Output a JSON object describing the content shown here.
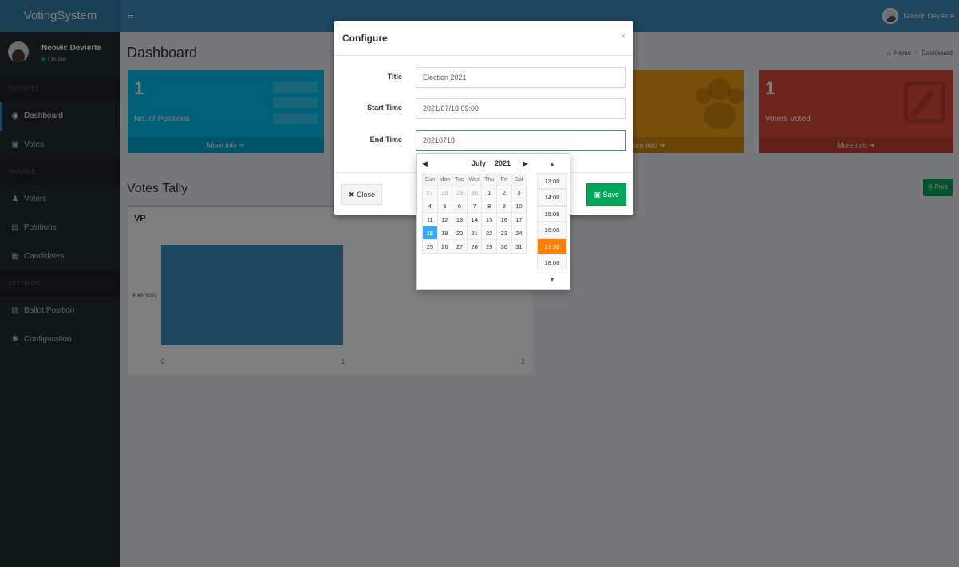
{
  "app": {
    "name": "VotingSystem",
    "toggle_glyph": "≡"
  },
  "topbar": {
    "user_name": "Neovic Devierte"
  },
  "sidebar": {
    "user": {
      "name": "Neovic Devierte",
      "status": "Online"
    },
    "sections": [
      {
        "header": "REPORTS",
        "items": [
          {
            "label": "Dashboard",
            "icon": "dashboard-icon",
            "active": true
          },
          {
            "label": "Votes",
            "icon": "lock-icon"
          }
        ]
      },
      {
        "header": "MANAGE",
        "items": [
          {
            "label": "Voters",
            "icon": "users-icon"
          },
          {
            "label": "Positions",
            "icon": "list-icon"
          },
          {
            "label": "Candidates",
            "icon": "candidates-icon"
          }
        ]
      },
      {
        "header": "SETTINGS",
        "items": [
          {
            "label": "Ballot Position",
            "icon": "file-icon"
          },
          {
            "label": "Configuration",
            "icon": "gear-icon"
          }
        ]
      }
    ]
  },
  "content": {
    "page_title": "Dashboard",
    "breadcrumb": {
      "home": "Home",
      "current": "Dashboard"
    },
    "boxes": [
      {
        "number": "1",
        "label": "No. of Positions",
        "footer": "More info",
        "color": "#00c0ef"
      },
      {
        "number": "",
        "label": "",
        "footer": "More info",
        "color": "#f39c12"
      },
      {
        "number": "1",
        "label": "Voters Voted",
        "footer": "More info",
        "color": "#dd4b39"
      }
    ],
    "section_title": "Votes Tally",
    "print_label": "Print",
    "chart_title": "VP"
  },
  "chart_data": {
    "type": "bar",
    "orientation": "horizontal",
    "title": "VP",
    "categories": [
      "Kashkov"
    ],
    "values": [
      1
    ],
    "xlim": [
      0,
      2
    ],
    "x_ticks": [
      "0",
      "1",
      "2"
    ],
    "color": "#3c8dbc"
  },
  "modal": {
    "title": "Configure",
    "close_glyph": "×",
    "fields": {
      "title": {
        "label": "Title",
        "value": "Election 2021"
      },
      "start": {
        "label": "Start Time",
        "value": "2021/07/18 09:00"
      },
      "end": {
        "label": "End Time",
        "value": "20210718"
      }
    },
    "close_label": "Close",
    "save_label": "Save"
  },
  "datepicker": {
    "month": "July",
    "year": "2021",
    "weekdays": [
      "Sun",
      "Mon",
      "Tue",
      "Wed",
      "Thu",
      "Fri",
      "Sat"
    ],
    "weeks": [
      [
        "27",
        "28",
        "29",
        "30",
        "1",
        "2",
        "3"
      ],
      [
        "4",
        "5",
        "6",
        "7",
        "8",
        "9",
        "10"
      ],
      [
        "11",
        "12",
        "13",
        "14",
        "15",
        "16",
        "17"
      ],
      [
        "18",
        "19",
        "20",
        "21",
        "22",
        "23",
        "24"
      ],
      [
        "25",
        "26",
        "27",
        "28",
        "29",
        "30",
        "31"
      ]
    ],
    "selected_day": "18",
    "times": [
      "13:00",
      "14:00",
      "15:00",
      "16:00",
      "17:00",
      "18:00"
    ],
    "selected_time": "17:00",
    "selected_color": "#3399ff",
    "time_color": "#ff8000"
  }
}
